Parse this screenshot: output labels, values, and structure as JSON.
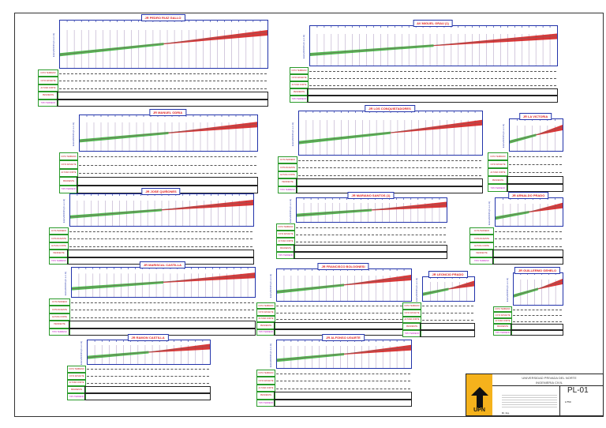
{
  "sheet": {
    "row_labels": [
      "COTA TERRENO",
      "COTA RASANTE",
      "ALTURA CORTE",
      "PENDIENTE",
      "TIPO TERRENO"
    ],
    "y_axis_label": "ELEVACION (m.s.n.m)",
    "profiles": [
      {
        "title": "JR PEDRO RUIZ GALLO"
      },
      {
        "title": "AV MIGUEL GRAU (1)"
      },
      {
        "title": "JR MANUEL ODRIA"
      },
      {
        "title": "JR LOS CONQUISTADORES"
      },
      {
        "title": "JR LA VICTORIA"
      },
      {
        "title": "JR JOSE QUIÑONES"
      },
      {
        "title": "JR MARIANO SANTOS (1)"
      },
      {
        "title": "JR ARNALDO PRADO"
      },
      {
        "title": "JR MARISCAL CASTILLA"
      },
      {
        "title": "JR FRANCISCO BOLOGNESI"
      },
      {
        "title": "JR LEONCIO PRADO"
      },
      {
        "title": "JR GUILLERMO GEHELO"
      },
      {
        "title": "JR RAMON CASTILLA"
      },
      {
        "title": "JR ALFONSO UGARTE"
      }
    ]
  },
  "title_block": {
    "logo_text": "UPN",
    "university": "UNIVERSIDAD PRIVADA DEL NORTE",
    "faculty": "INGENIERIA CIVIL",
    "sheet_code": "PL-01",
    "scale": "1/750",
    "advisor": "Dr. Ing."
  },
  "colors": {
    "cut": "#d01818",
    "fill": "#28a828",
    "frame": "#2233aa"
  }
}
